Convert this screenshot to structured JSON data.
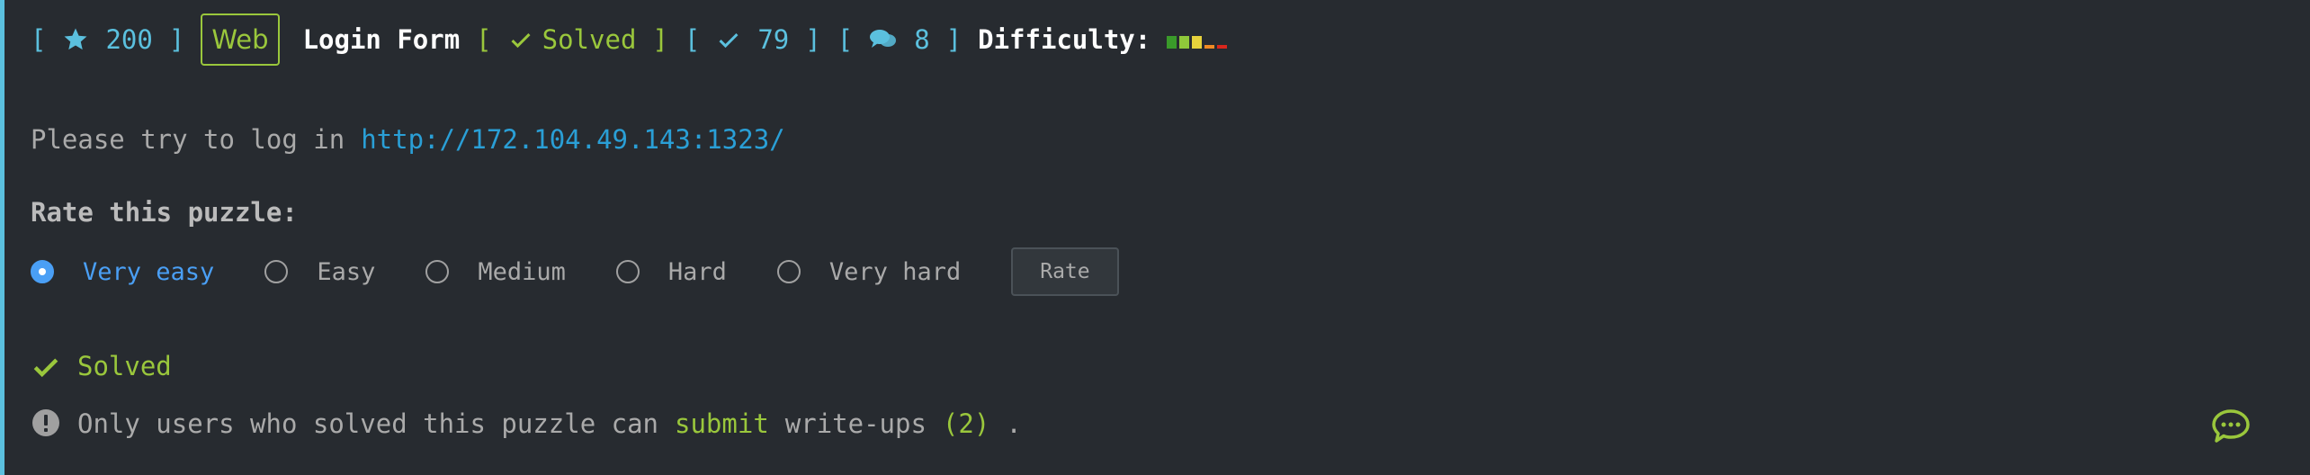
{
  "header": {
    "open_bracket": "[",
    "close_bracket": "]",
    "points": "200",
    "category": "Web",
    "title": "Login Form",
    "status": "Solved",
    "solves": "79",
    "comments": "8",
    "difficulty_label": "Difficulty:",
    "difficulty_colors": [
      "#3a9a2a",
      "#8fc83a",
      "#e6d23c",
      "#f08a24",
      "#d9261c"
    ]
  },
  "intro": {
    "text": "Please try to log in",
    "link": "http://172.104.49.143:1323/"
  },
  "rating": {
    "title": "Rate this puzzle:",
    "options": [
      "Very easy",
      "Easy",
      "Medium",
      "Hard",
      "Very hard"
    ],
    "selected": "Very easy",
    "button": "Rate"
  },
  "solved": {
    "label": "Solved"
  },
  "notice": {
    "prefix": "Only users who solved this puzzle can",
    "link": "submit",
    "middle": "write-ups",
    "count": "(2)",
    "suffix": "."
  },
  "colors": {
    "background": "#272b30",
    "accent": "#5bc0de",
    "green": "#9ac73c",
    "link": "#2a9fd6"
  }
}
